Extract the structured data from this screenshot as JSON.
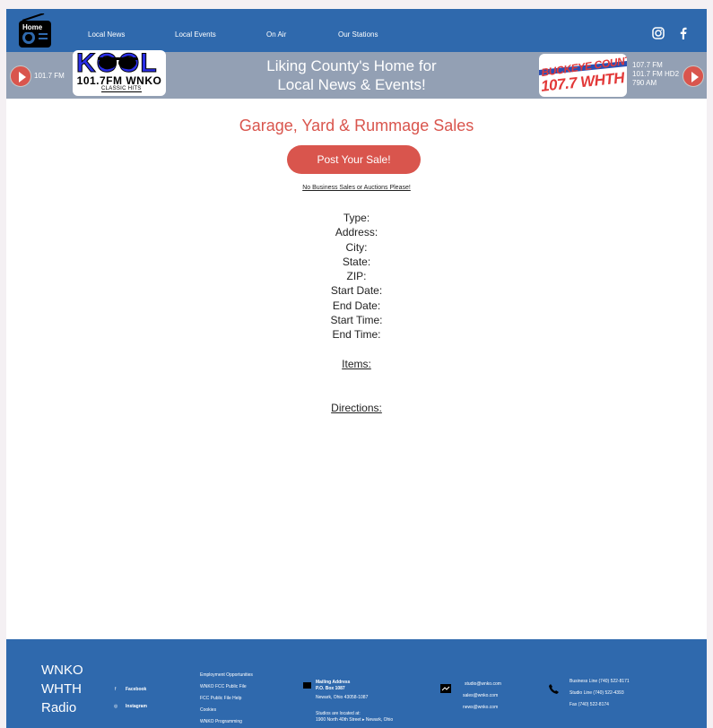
{
  "nav": {
    "home_label": "Home",
    "links": [
      "Local News",
      "Local Events",
      "On Air",
      "Our Stations"
    ]
  },
  "banner": {
    "left_freq": "101.7 FM",
    "kool_logo_text": "KOOL",
    "kool_logo_sub": "101.7FM  WNKO",
    "kool_logo_classic": "CLASSIC HITS",
    "tagline_line1": "Liking County's Home for",
    "tagline_line2": "Local News & Events!",
    "buckeye_logo_top": "BUCKEYE COUNTRY",
    "buckeye_logo_bottom": "107.7 WHTH",
    "right_freq_1": "107.7 FM",
    "right_freq_2": "101.7 FM HD2",
    "right_freq_3": "790 AM"
  },
  "main": {
    "title": "Garage, Yard & Rummage Sales",
    "post_button": "Post Your Sale!",
    "note": "No Business Sales or Auctions Please!",
    "fields": [
      "Type:",
      "Address:",
      "City:",
      "State:",
      "ZIP:",
      "Start Date:",
      "End Date:",
      "Start Time:",
      "End Time:"
    ],
    "items_label": "Items:",
    "directions_label": "Directions:"
  },
  "footer": {
    "brand": [
      "WNKO",
      "WHTH",
      "Radio"
    ],
    "social": [
      "Facebook",
      "Instagram"
    ],
    "links": [
      "Employment Opportunities",
      "WNKO FCC Public File",
      "FCC Public File Help",
      "Cookies",
      "WNKO Programming"
    ],
    "mailing_title": "Mailing Address",
    "mailing_line1": "P.O. Box 1087",
    "mailing_line2": "Newark, Ohio 43058-1087",
    "studio_line1": "Studios are located at:",
    "studio_line2": "1900 North 40th Street ▸ Newark, Ohio",
    "emails": [
      "studio@wnko.com",
      "sales@wnko.com",
      "news@wnko.com"
    ],
    "phones": [
      "Business Line (740) 522-8171",
      "Studio Line (740) 522-4393",
      "Fax (740) 522-8174"
    ]
  },
  "colors": {
    "nav_blue": "#2f69ad",
    "accent_red": "#d9554d",
    "banner_gray": "#93a0b4"
  },
  "icons": [
    "radio-icon",
    "instagram-icon",
    "facebook-icon",
    "play-icon",
    "email-icon",
    "phone-icon"
  ]
}
